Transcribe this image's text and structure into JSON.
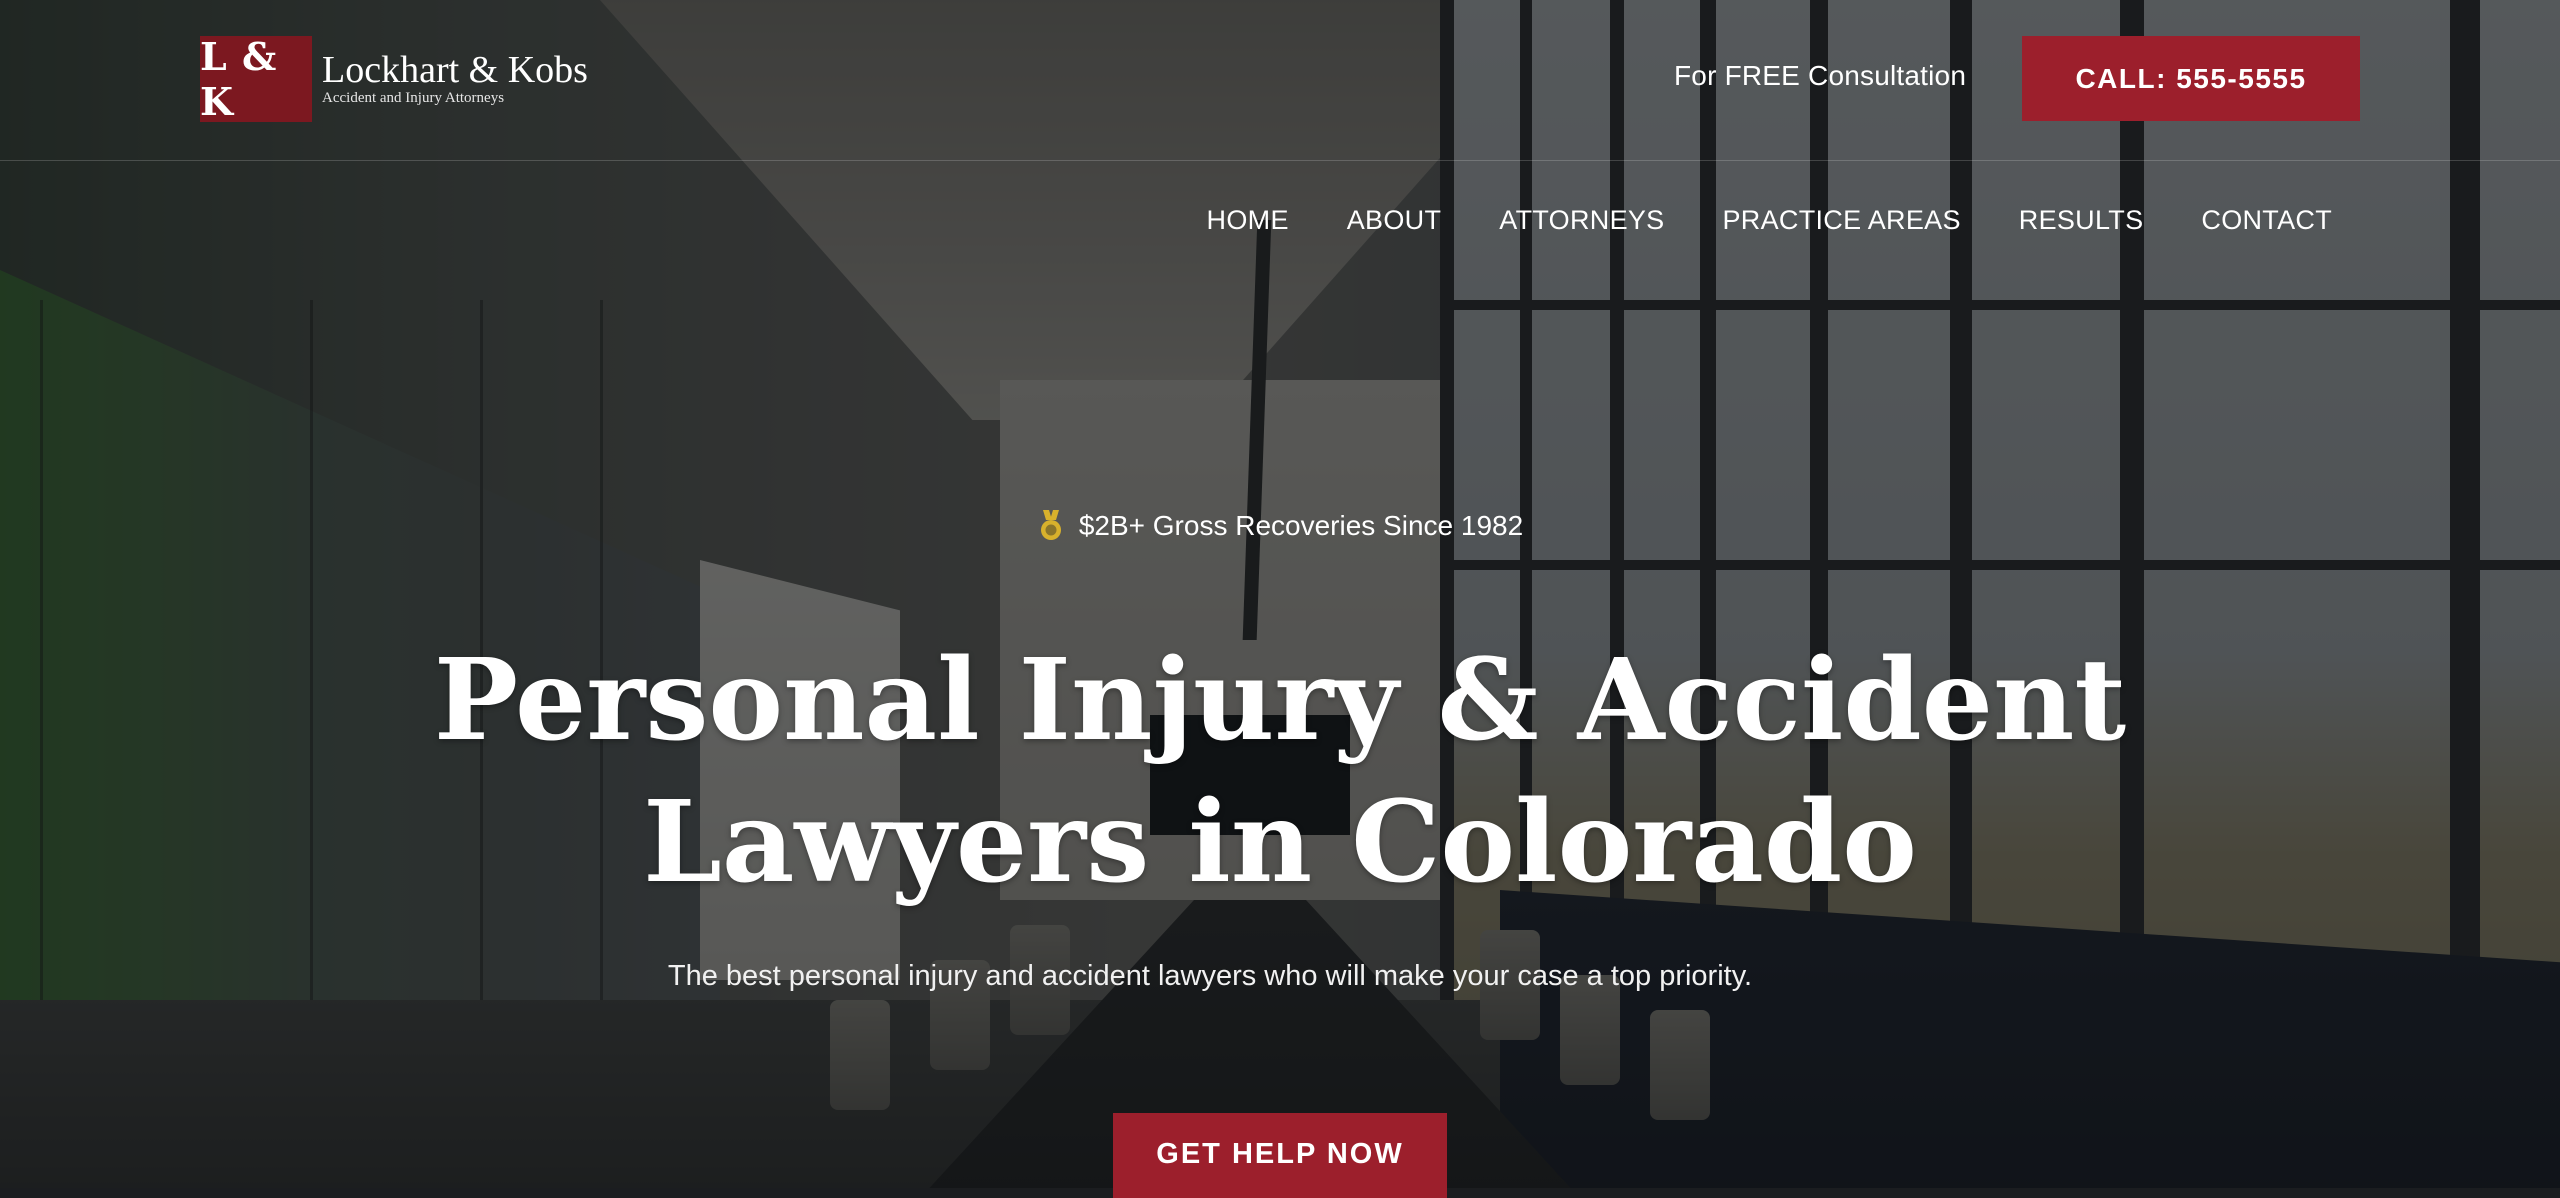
{
  "header": {
    "logo_mark": "L & K",
    "logo_name": "Lockhart & Kobs",
    "logo_tagline": "Accident and Injury Attorneys",
    "consult_text": "For FREE Consultation",
    "call_label": "CALL: 555-5555"
  },
  "nav": {
    "items": [
      {
        "label": "HOME"
      },
      {
        "label": "ABOUT"
      },
      {
        "label": "ATTORNEYS"
      },
      {
        "label": "PRACTICE AREAS"
      },
      {
        "label": "RESULTS"
      },
      {
        "label": "CONTACT"
      }
    ]
  },
  "hero": {
    "badge_icon": "medal-icon",
    "badge_text": "$2B+ Gross Recoveries Since 1982",
    "title_line1": "Personal Injury & Accident",
    "title_line2": "Lawyers in Colorado",
    "subtitle": "The best personal injury and accident lawyers who will make your case a top priority.",
    "cta_label": "GET HELP NOW"
  },
  "colors": {
    "brand_red": "#9c1f2c",
    "logo_red": "#7c1820",
    "medal_gold": "#d8b12c",
    "text": "#ffffff"
  }
}
